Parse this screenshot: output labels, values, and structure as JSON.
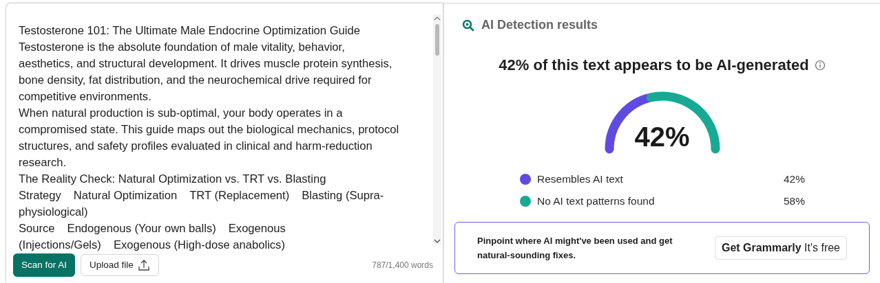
{
  "editor": {
    "title": "Testosterone 101: The Ultimate Male Endocrine Optimization Guide",
    "paragraphs": [
      "Testosterone is the absolute foundation of male vitality, behavior, aesthetics, and structural development. It drives muscle protein synthesis, bone density, fat distribution, and the neurochemical drive required for competitive environments.",
      "When natural production is sub-optimal, your body operates in a compromised state. This guide maps out the biological mechanics, protocol structures, and safety profiles evaluated in clinical and harm-reduction research.",
      "The Reality Check: Natural Optimization vs. TRT vs. Blasting"
    ],
    "table_rows": [
      [
        "Strategy",
        "Natural Optimization",
        "TRT (Replacement)",
        "Blasting (Supra-physiological)"
      ],
      [
        "Source",
        "Endogenous (Your own balls)",
        "Exogenous (Injections/Gels)",
        "Exogenous (High-dose anabolics)"
      ]
    ],
    "scan_button": "Scan for AI",
    "upload_button": "Upload file",
    "word_count": "787/1,400 words"
  },
  "results": {
    "title": "AI Detection results",
    "headline": "42% of this text appears to be AI-generated",
    "gauge": {
      "reading": "42%"
    },
    "legend": [
      {
        "label": "Resembles AI text",
        "value": "42%",
        "color": "#5f4ae2"
      },
      {
        "label": "No AI text patterns found",
        "value": "58%",
        "color": "#18a995"
      }
    ],
    "promo": {
      "text": "Pinpoint where AI might've been used and get natural-sounding fixes.",
      "button": "**Get Grammarly** It's free"
    }
  }
}
